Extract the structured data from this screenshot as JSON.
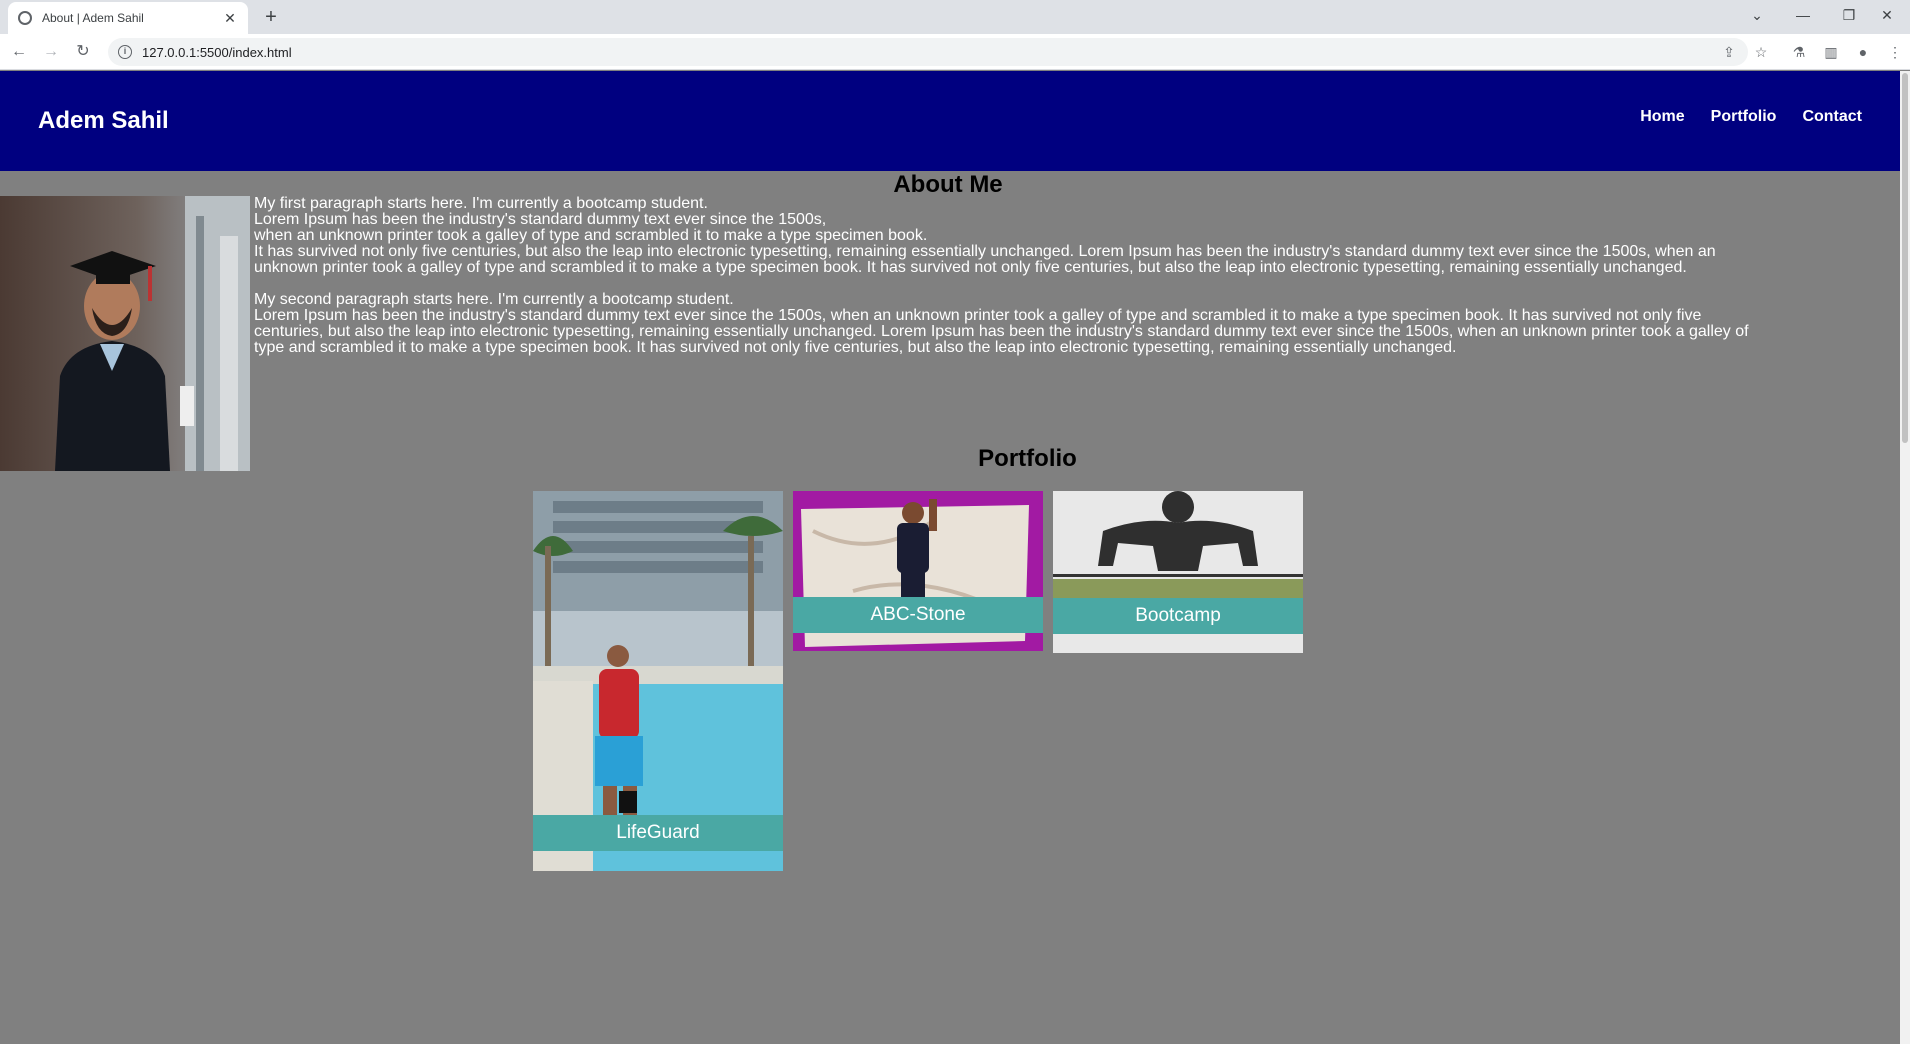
{
  "browser": {
    "tab_title": "About | Adem Sahil",
    "url": "127.0.0.1:5500/index.html"
  },
  "header": {
    "brand": "Adem Sahil",
    "nav": [
      {
        "label": "Home"
      },
      {
        "label": "Portfolio"
      },
      {
        "label": "Contact"
      }
    ]
  },
  "about": {
    "title": "About Me",
    "paragraphs": [
      {
        "lines": [
          "My first paragraph starts here. I'm currently a bootcamp student.",
          "Lorem Ipsum has been the industry's standard dummy text ever since the 1500s,",
          "when an unknown printer took a galley of type and scrambled it to make a type specimen book.",
          "It has survived not only five centuries, but also the leap into electronic typesetting, remaining essentially unchanged. Lorem Ipsum has been the industry's standard dummy text ever since the 1500s, when an unknown printer took a galley of type and scrambled it to make a type specimen book. It has survived not only five centuries, but also the leap into electronic typesetting, remaining essentially unchanged."
        ]
      },
      {
        "lines": [
          "My second paragraph starts here. I'm currently a bootcamp student.",
          "Lorem Ipsum has been the industry's standard dummy text ever since the 1500s, when an unknown printer took a galley of type and scrambled it to make a type specimen book. It has survived not only five centuries, but also the leap into electronic typesetting, remaining essentially unchanged. Lorem Ipsum has been the industry's standard dummy text ever since the 1500s, when an unknown printer took a galley of type and scrambled it to make a type specimen book. It has survived not only five centuries, but also the leap into electronic typesetting, remaining essentially unchanged."
        ]
      }
    ]
  },
  "portfolio": {
    "title": "Portfolio",
    "items": [
      {
        "label": "LifeGuard"
      },
      {
        "label": "ABC-Stone"
      },
      {
        "label": "Bootcamp"
      }
    ]
  },
  "colors": {
    "header_bg": "#000080",
    "page_bg": "#808080",
    "card_label_bg": "#4aa8a4"
  }
}
